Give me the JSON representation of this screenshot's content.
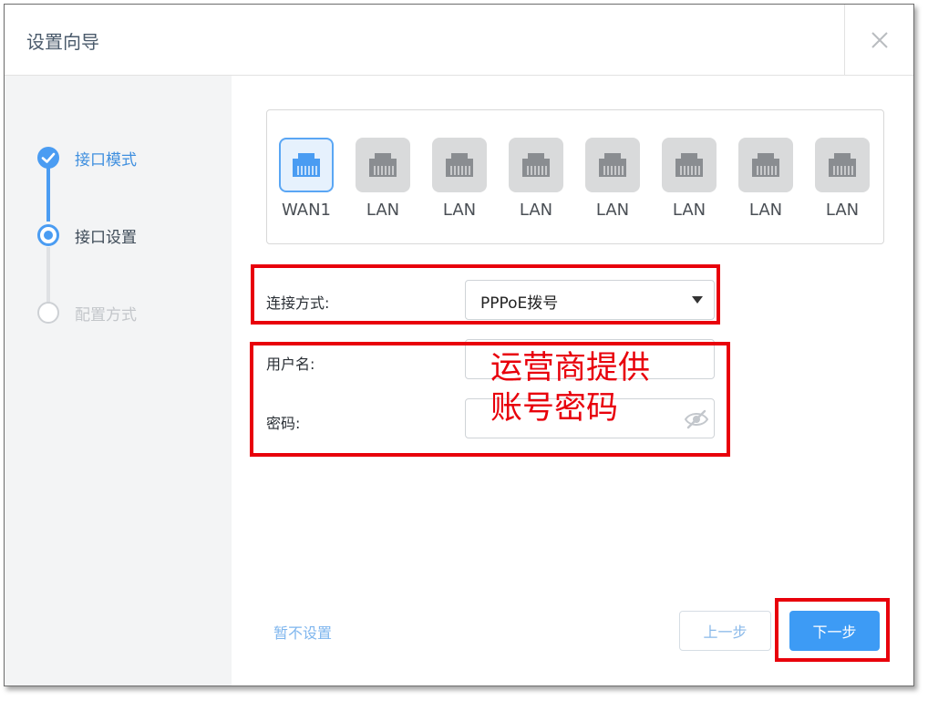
{
  "dialog": {
    "title": "设置向导"
  },
  "steps": [
    {
      "label": "接口模式",
      "state": "done"
    },
    {
      "label": "接口设置",
      "state": "current"
    },
    {
      "label": "配置方式",
      "state": "todo"
    }
  ],
  "ports": [
    {
      "name": "WAN1",
      "active": true
    },
    {
      "name": "LAN",
      "active": false
    },
    {
      "name": "LAN",
      "active": false
    },
    {
      "name": "LAN",
      "active": false
    },
    {
      "name": "LAN",
      "active": false
    },
    {
      "name": "LAN",
      "active": false
    },
    {
      "name": "LAN",
      "active": false
    },
    {
      "name": "LAN",
      "active": false
    }
  ],
  "form": {
    "connection_label": "连接方式:",
    "connection_value": "PPPoE拨号",
    "username_label": "用户名:",
    "username_value": "",
    "password_label": "密码:",
    "password_value": ""
  },
  "annotation": {
    "line1": "运营商提供",
    "line2": "账号密码"
  },
  "footer": {
    "skip": "暂不设置",
    "prev": "上一步",
    "next": "下一步"
  },
  "colors": {
    "accent": "#4a9cf2",
    "highlight": "#e8000b"
  },
  "icons": {
    "close": "close-icon",
    "check": "check-icon",
    "port": "ethernet-port-icon",
    "eye": "eye-hidden-icon"
  }
}
